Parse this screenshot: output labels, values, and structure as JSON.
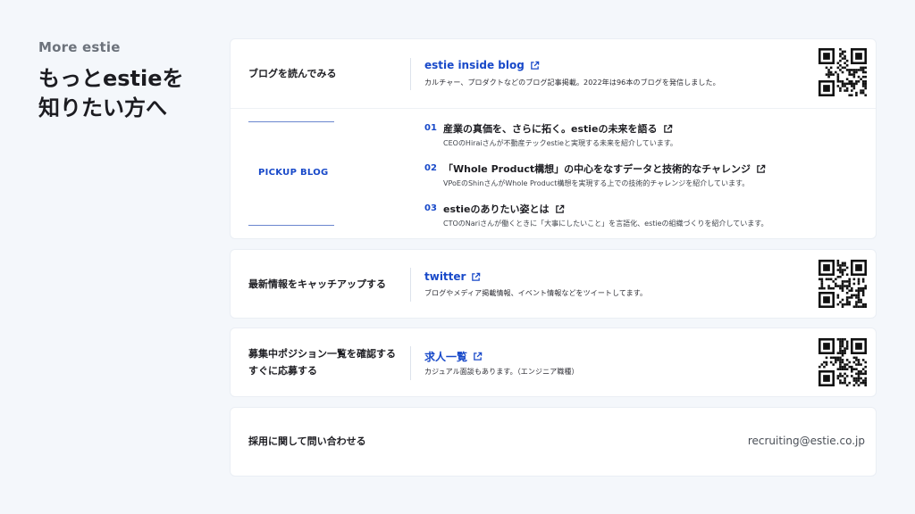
{
  "intro": {
    "eyebrow": "More estie",
    "headline_line1": "もっとestieを",
    "headline_line2": "知りたい方へ"
  },
  "blog": {
    "label": "ブログを読んでみる",
    "link": "estie inside blog",
    "desc": "カルチャー、プロダクトなどのブログ記事掲載。2022年は96本のブログを発信しました。",
    "pickup_label": "PICKUP BLOG",
    "items": [
      {
        "num": "01",
        "title": "産業の真価を、さらに拓く。estieの未来を語る",
        "sub": "CEOのHiraiさんが不動産テックestieと実現する未来を紹介しています。"
      },
      {
        "num": "02",
        "title": "「Whole Product構想」の中心をなすデータと技術的なチャレンジ",
        "sub": "VPoEのShinさんがWhole Product構想を実現する上での技術的チャレンジを紹介しています。"
      },
      {
        "num": "03",
        "title": "estieのありたい姿とは",
        "sub": "CTOのNariさんが働くときに「大事にしたいこと」を言語化、estieの組織づくりを紹介しています。"
      }
    ]
  },
  "twitter": {
    "label": "最新情報をキャッチアップする",
    "link": "twitter",
    "desc": "ブログやメディア掲載情報、イベント情報などをツイートしてます。"
  },
  "jobs": {
    "label_line1": "募集中ポジション一覧を確認する",
    "label_line2": "すぐに応募する",
    "link": "求人一覧",
    "desc": "カジュアル面談もあります。（エンジニア職種）"
  },
  "contact": {
    "label": "採用に関して問い合わせる",
    "email": "recruiting@estie.co.jp"
  },
  "colors": {
    "accent": "#1849c9",
    "background": "#f4f7fb",
    "card": "#ffffff"
  },
  "icons": [
    "external-link-icon",
    "qr-code-icon"
  ]
}
